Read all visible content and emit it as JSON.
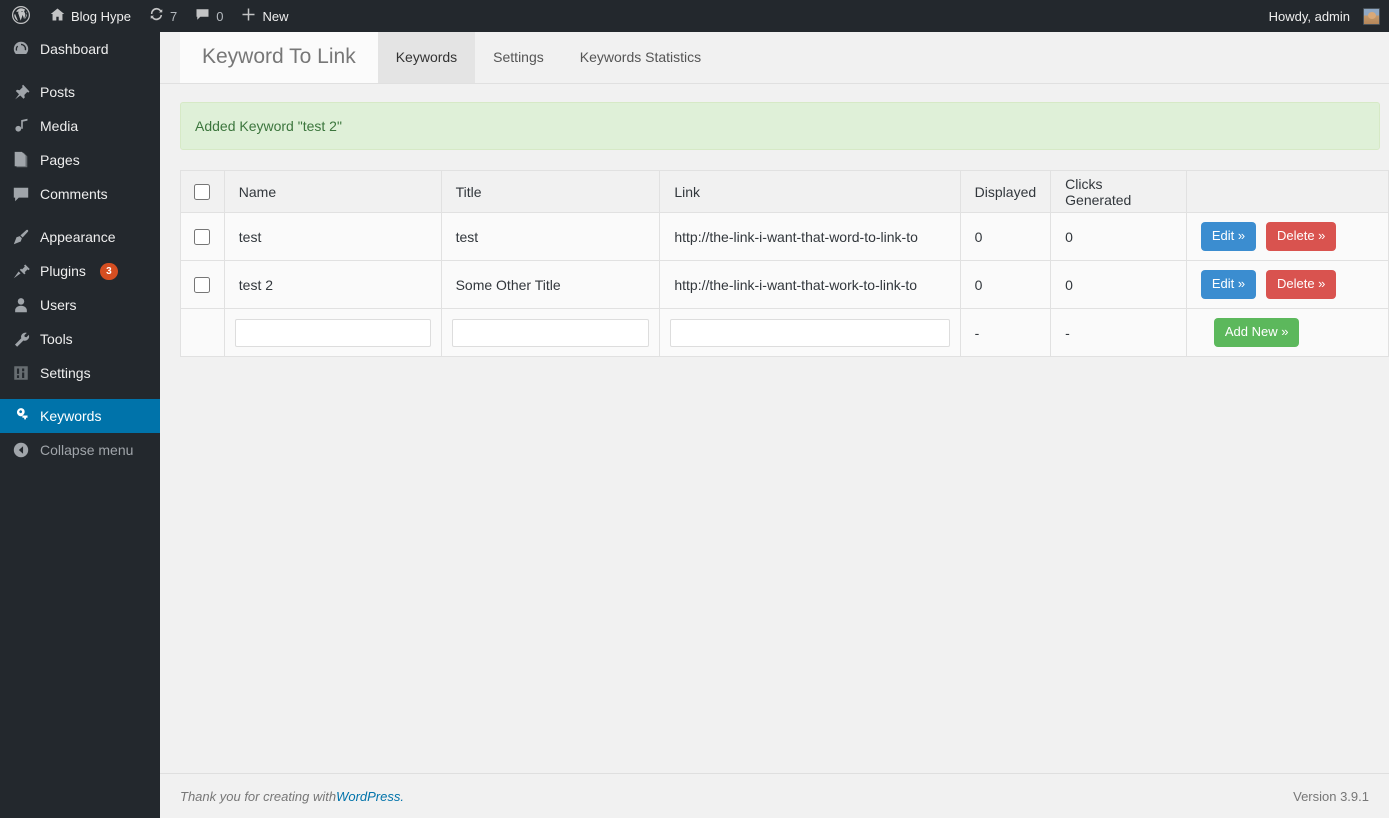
{
  "adminbar": {
    "logo_icon": "wordpress-logo-icon",
    "site_name": "Blog Hype",
    "site_icon": "home-icon",
    "updates_icon": "updates-icon",
    "updates_count": "7",
    "comments_icon": "comment-bubble-icon",
    "comments_count": "0",
    "new_icon": "plus-icon",
    "new_label": "New",
    "howdy": "Howdy, admin",
    "avatar_icon": "user-avatar"
  },
  "sidebar": {
    "items": [
      {
        "label": "Dashboard",
        "icon": "dashboard-icon",
        "badge": ""
      },
      {
        "label": "Posts",
        "icon": "pin-icon",
        "badge": ""
      },
      {
        "label": "Media",
        "icon": "media-icon",
        "badge": ""
      },
      {
        "label": "Pages",
        "icon": "pages-icon",
        "badge": ""
      },
      {
        "label": "Comments",
        "icon": "comment-bubble-icon",
        "badge": ""
      },
      {
        "label": "Appearance",
        "icon": "paintbrush-icon",
        "badge": ""
      },
      {
        "label": "Plugins",
        "icon": "plug-icon",
        "badge": "3"
      },
      {
        "label": "Users",
        "icon": "user-icon",
        "badge": ""
      },
      {
        "label": "Tools",
        "icon": "wrench-icon",
        "badge": ""
      },
      {
        "label": "Settings",
        "icon": "settings-sliders-icon",
        "badge": ""
      },
      {
        "label": "Keywords",
        "icon": "key-icon",
        "badge": ""
      }
    ],
    "collapse_label": "Collapse menu",
    "collapse_icon": "arrow-left-circle-icon",
    "current_item": "Keywords",
    "highlight_color": "#0073aa",
    "badge_color": "#d54e21"
  },
  "page": {
    "brand_title": "Keyword To Link",
    "tabs": [
      {
        "label": "Keywords",
        "active": true
      },
      {
        "label": "Settings",
        "active": false
      },
      {
        "label": "Keywords Statistics",
        "active": false
      }
    ],
    "notice": {
      "text": "Added Keyword \"test 2\"",
      "background": "#dff0d8",
      "text_color": "#3c763d"
    },
    "table": {
      "columns": [
        "",
        "Name",
        "Title",
        "Link",
        "Displayed",
        "Clicks Generated",
        ""
      ],
      "rows": [
        {
          "name": "test",
          "title": "test",
          "link": "http://the-link-i-want-that-word-to-link-to",
          "displayed": "0",
          "clicks": "0",
          "edit_label": "Edit »",
          "delete_label": "Delete »"
        },
        {
          "name": "test 2",
          "title": "Some Other Title",
          "link": "http://the-link-i-want-that-work-to-link-to",
          "displayed": "0",
          "clicks": "0",
          "edit_label": "Edit »",
          "delete_label": "Delete »"
        }
      ],
      "new_row": {
        "name_value": "",
        "title_value": "",
        "link_value": "",
        "displayed": "-",
        "clicks": "-",
        "add_label": "Add New »"
      },
      "button_colors": {
        "edit": "#3b8dd0",
        "delete": "#d9534f",
        "add": "#5cb85c"
      }
    }
  },
  "footer": {
    "thanks_prefix": "Thank you for creating with ",
    "wordpress_link": "WordPress.",
    "version": "Version 3.9.1"
  }
}
